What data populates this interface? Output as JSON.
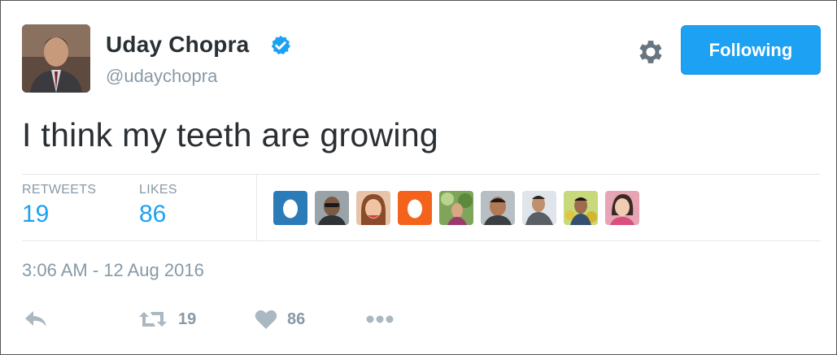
{
  "user": {
    "display_name": "Uday Chopra",
    "screen_name": "@udaychopra",
    "verified": true
  },
  "header": {
    "follow_button_label": "Following"
  },
  "tweet": {
    "text": "I think my teeth are growing",
    "timestamp": "3:06 AM - 12 Aug 2016"
  },
  "stats": {
    "retweets_label": "RETWEETS",
    "retweets_count": "19",
    "likes_label": "LIKES",
    "likes_count": "86"
  },
  "likers": [
    "default-egg-avatar-blue",
    "user-avatar",
    "user-avatar",
    "default-egg-avatar-orange",
    "user-avatar",
    "user-avatar",
    "user-avatar",
    "user-avatar",
    "user-avatar"
  ],
  "actions": {
    "retweet_count": "19",
    "like_count": "86"
  },
  "colors": {
    "accent": "#1da1f2",
    "text": "#292f33",
    "muted": "#8899a6",
    "icon": "#aab8c2",
    "divider": "#e1e8ed"
  }
}
